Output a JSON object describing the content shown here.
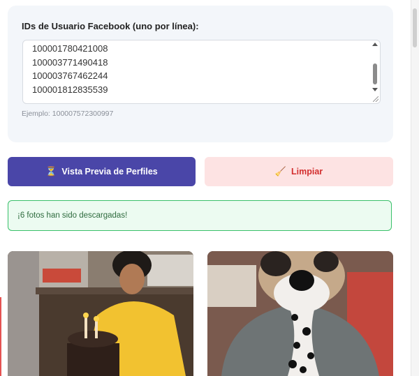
{
  "form": {
    "ids_label": "IDs de Usuario Facebook (uno por línea):",
    "ids_lines": [
      "100001780421008",
      "100003771490418",
      "100003767462244",
      "100001812835539"
    ],
    "example_text": "Ejemplo: 100007572300997"
  },
  "actions": {
    "preview_icon": "⏳",
    "preview_label": "Vista Previa de Perfiles",
    "clear_icon": "🧹",
    "clear_label": "Limpiar"
  },
  "alert": {
    "message": "¡6 fotos han sido descargadas!"
  },
  "colors": {
    "primary": "#4a46a8",
    "danger_text": "#d32f2f",
    "danger_bg": "#fde3e3",
    "success_border": "#39c06a",
    "success_bg": "#ecfbf1"
  },
  "icons": {
    "preview": "hourglass-icon",
    "clear": "broom-icon"
  }
}
